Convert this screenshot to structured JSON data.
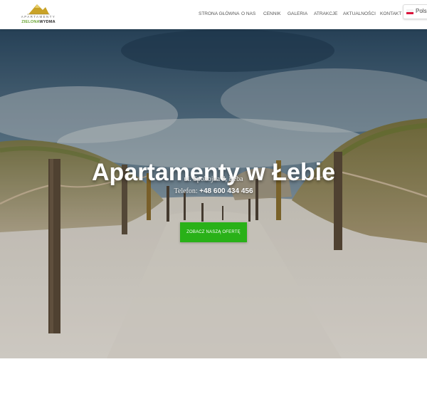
{
  "logo": {
    "line1": "APARTAMENTY",
    "line2_green": "ZIELONA",
    "line2_dark": "WYDMA",
    "icon": "mountain-logo-icon",
    "colors": {
      "gold": "#c9a227",
      "green": "#6aa533",
      "dark": "#2b2b2b"
    }
  },
  "nav": {
    "items": [
      {
        "label": "STRONA GŁÓWNA"
      },
      {
        "label": "O NAS"
      },
      {
        "label": "CENNIK"
      },
      {
        "label": "GALERIA"
      },
      {
        "label": "ATRAKCJE"
      },
      {
        "label": "AKTUALNOŚCI"
      },
      {
        "label": "KONTAKT"
      }
    ]
  },
  "language": {
    "label": "Polsk",
    "flag": "poland-flag-icon"
  },
  "hero": {
    "title": "Apartamenty w Łebie",
    "address": "ul. Spokojna 3, Łeba",
    "phone_label": "Telefon: ",
    "phone": "+48 600 434 456",
    "cta_label": "ZOBACZ NASZĄ OFERTĘ",
    "cta_color": "#29b118",
    "image": "beach-dune-path-photo"
  }
}
